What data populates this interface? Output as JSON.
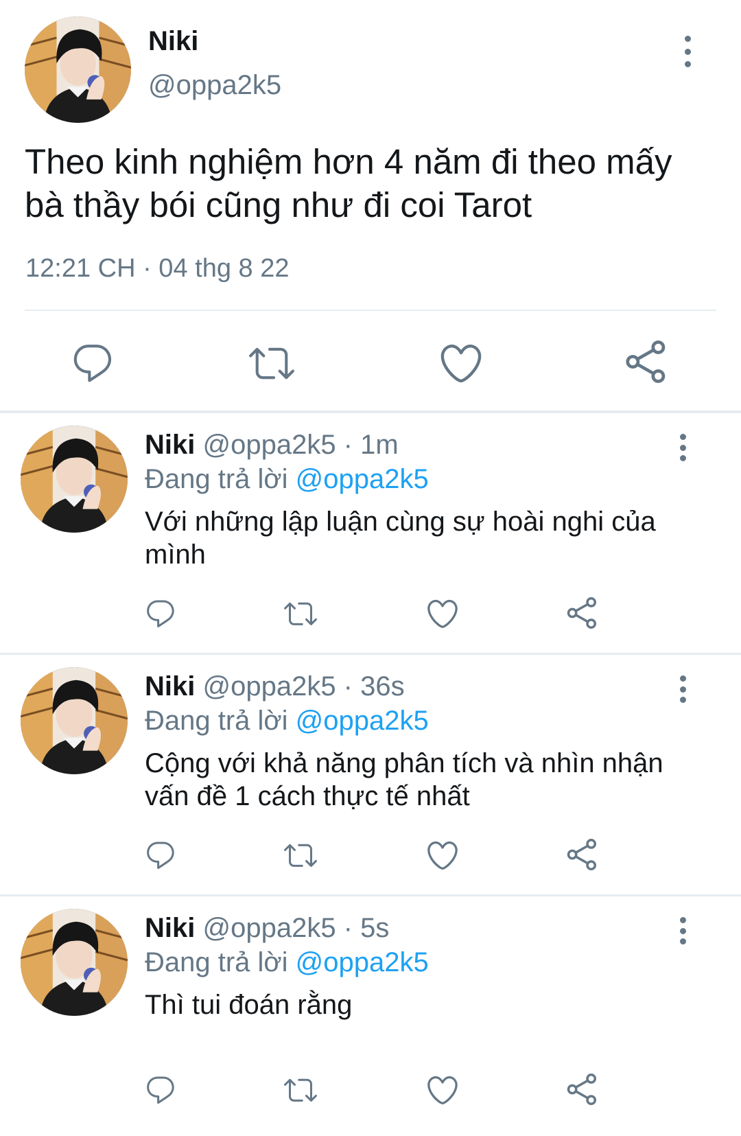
{
  "main_tweet": {
    "name": "Niki",
    "handle": "@oppa2k5",
    "text": "Theo kinh nghiệm hơn 4 năm đi theo mấy bà thầy bói cũng như đi coi Tarot",
    "timestamp": "12:21 CH · 04 thg 8 22",
    "actions": [
      "reply-icon",
      "retweet-icon",
      "like-icon",
      "share-icon"
    ]
  },
  "replies": [
    {
      "name": "Niki",
      "meta": "@oppa2k5 · 1m",
      "replying_label": "Đang trả lời",
      "replying_to": "@oppa2k5",
      "text": "Với những lập luận cùng sự hoài nghi của mình"
    },
    {
      "name": "Niki",
      "meta": "@oppa2k5 · 36s",
      "replying_label": "Đang trả lời",
      "replying_to": "@oppa2k5",
      "text": "Cộng với khả năng phân tích và nhìn nhận vấn đề 1 cách thực tế nhất"
    },
    {
      "name": "Niki",
      "meta": "@oppa2k5 · 5s",
      "replying_label": "Đang trả lời",
      "replying_to": "@oppa2k5",
      "text": "Thì tui đoán rằng"
    }
  ],
  "colors": {
    "text": "#14171a",
    "secondary": "#657786",
    "link": "#1da1f2",
    "separator": "#e6ecf0"
  }
}
